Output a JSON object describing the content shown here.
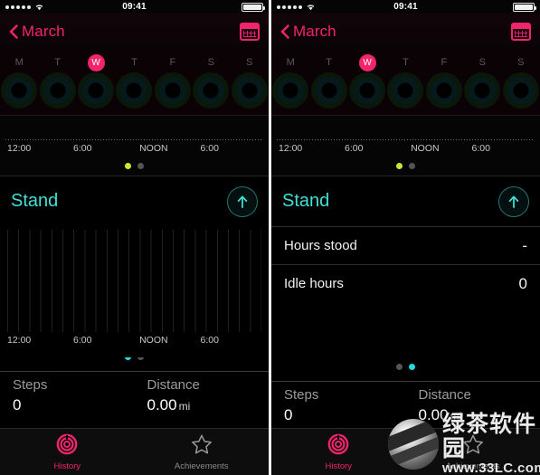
{
  "status_bar": {
    "signal_dots": 5,
    "wifi_icon": "wifi-icon",
    "time": "09:41",
    "battery_icon": "battery-full-icon"
  },
  "nav": {
    "back_icon": "chevron-left-icon",
    "back_label": "March",
    "calendar_icon": "calendar-icon"
  },
  "week": {
    "days": [
      {
        "label": "M",
        "today": false
      },
      {
        "label": "T",
        "today": false
      },
      {
        "label": "W",
        "today": true
      },
      {
        "label": "T",
        "today": false
      },
      {
        "label": "F",
        "today": false
      },
      {
        "label": "S",
        "today": false
      },
      {
        "label": "S",
        "today": false
      }
    ]
  },
  "timeline_top": {
    "ticks": [
      "12:00",
      "6:00",
      "NOON",
      "6:00"
    ],
    "dots": [
      {
        "state": "active-yellow"
      },
      {
        "state": "inactive"
      }
    ]
  },
  "stand_section": {
    "title": "Stand",
    "up_arrow_icon": "arrow-up-icon"
  },
  "left_panel": {
    "chart_ticks": [
      "12:00",
      "6:00",
      "NOON",
      "6:00"
    ],
    "chart_dots": [
      {
        "state": "active-cyan"
      },
      {
        "state": "inactive"
      }
    ]
  },
  "right_panel": {
    "rows": [
      {
        "key": "Hours stood",
        "value": "-"
      },
      {
        "key": "Idle hours",
        "value": "0"
      }
    ],
    "page_dots": [
      {
        "state": "inactive"
      },
      {
        "state": "active-cyan"
      }
    ]
  },
  "stats": {
    "steps_label": "Steps",
    "steps_value": "0",
    "distance_label": "Distance",
    "distance_value": "0.00",
    "distance_unit": "mi"
  },
  "tabbar": {
    "tabs": [
      {
        "label": "History",
        "icon": "activity-rings-icon",
        "active": true
      },
      {
        "label": "Achievements",
        "icon": "star-icon",
        "active": false
      }
    ]
  },
  "watermark": {
    "brand": "绿茶软件园",
    "url": "www.33LC.com",
    "globe_icon": "globe-icon"
  },
  "colors": {
    "accent_pink": "#f2246b",
    "stand_cyan": "#3fe0d6",
    "move_yellow": "#c8e838",
    "background": "#000000"
  }
}
